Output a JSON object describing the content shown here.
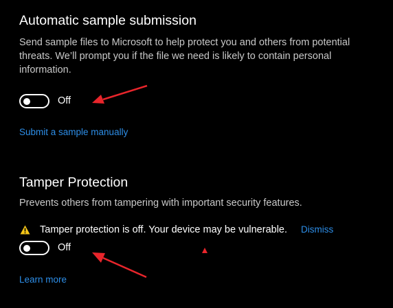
{
  "sample_submission": {
    "title": "Automatic sample submission",
    "description": "Send sample files to Microsoft to help protect you and others from potential threats. We’ll prompt you if the file we need is likely to contain personal information.",
    "toggle_state": "Off",
    "link": "Submit a sample manually"
  },
  "tamper_protection": {
    "title": "Tamper Protection",
    "description": "Prevents others from tampering with important security features.",
    "warning_icon": "warning-triangle-icon",
    "warning_text": "Tamper protection is off. Your device may be vulnerable.",
    "dismiss_link": "Dismiss",
    "toggle_state": "Off",
    "link": "Learn more"
  },
  "colors": {
    "background": "#000000",
    "accent_link": "#2d8ee8",
    "warning": "#f5c518",
    "annotation": "#e8252b"
  },
  "annotations": {
    "icon": "red-arrow-icon"
  }
}
